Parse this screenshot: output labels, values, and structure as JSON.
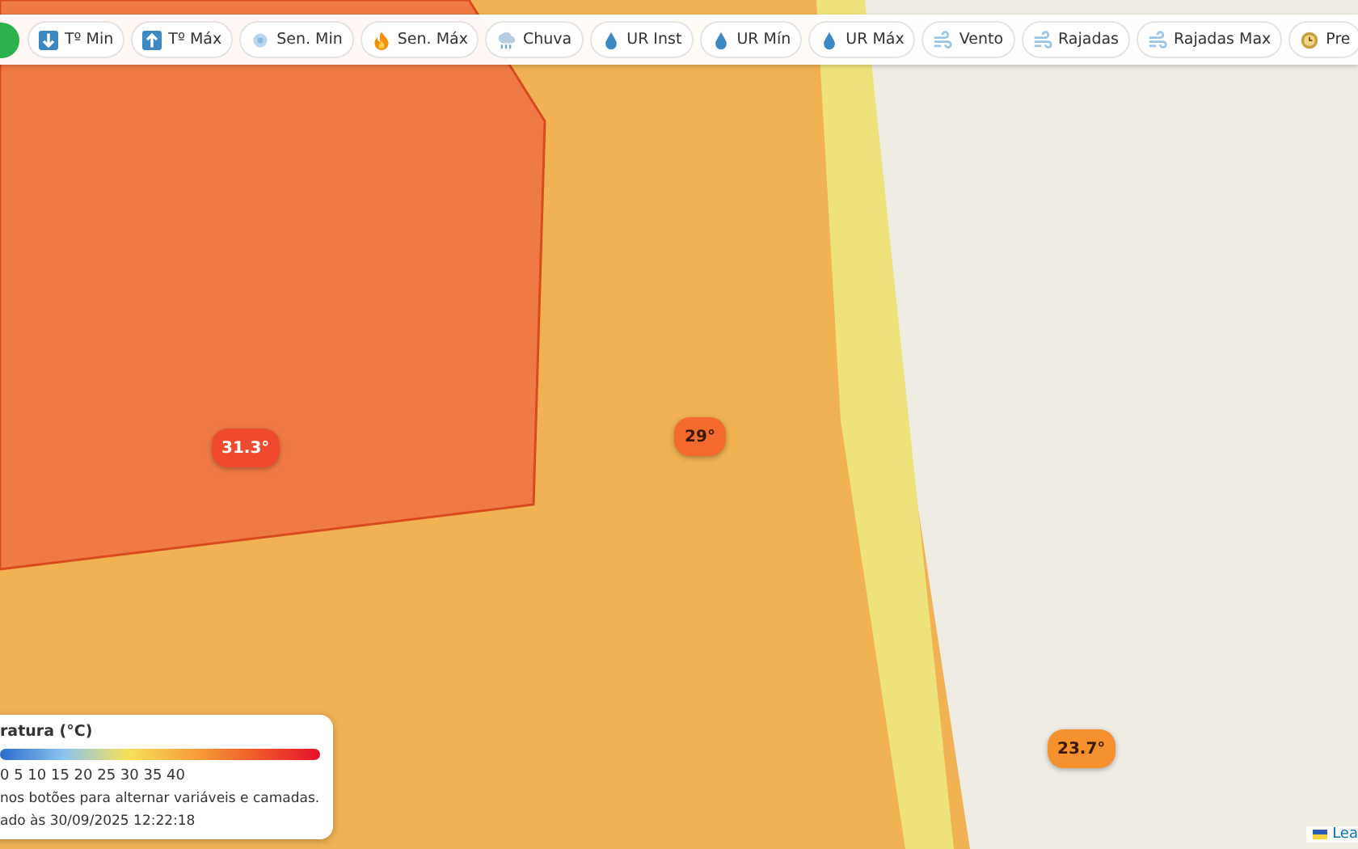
{
  "toolbar": {
    "buttons": [
      {
        "label": "Tº Min"
      },
      {
        "label": "Tº Máx"
      },
      {
        "label": "Sen. Min"
      },
      {
        "label": "Sen. Máx"
      },
      {
        "label": "Chuva"
      },
      {
        "label": "UR Inst"
      },
      {
        "label": "UR Mín"
      },
      {
        "label": "UR Máx"
      },
      {
        "label": "Vento"
      },
      {
        "label": "Rajadas"
      },
      {
        "label": "Rajadas Max"
      },
      {
        "label": "Pre"
      }
    ]
  },
  "map": {
    "markers": [
      {
        "value": "31.3°",
        "color": "#f04a2e"
      },
      {
        "value": "29°",
        "color": "#f46a2c"
      },
      {
        "value": "23.7°",
        "color": "#f4902e"
      }
    ],
    "attribution": "Lea"
  },
  "legend": {
    "title": "ratura (°C)",
    "scale": "0 5 10 15 20 25 30 35 40",
    "hint": "nos botões para alternar variáveis e camadas.",
    "updated": "ado às 30/09/2025 12:22:18"
  }
}
